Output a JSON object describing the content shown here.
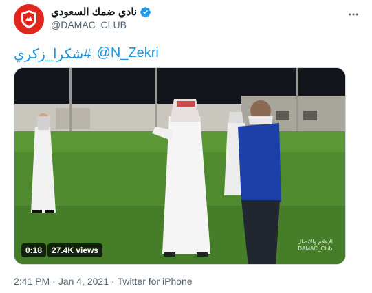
{
  "account": {
    "display_name": "نادي ضمك السعودي",
    "handle": "@DAMAC_CLUB"
  },
  "tweet": {
    "hashtag": "#شكرا_زكري",
    "mention": "@N_Zekri"
  },
  "video": {
    "duration": "0:18",
    "views": "27.4K views",
    "watermark_ar": "الإعلام والاتصال",
    "watermark_en": "DAMAC_Club"
  },
  "meta": {
    "time": "2:41 PM",
    "separator1": "·",
    "date": "Jan 4, 2021",
    "separator2": "·",
    "source": "Twitter for iPhone"
  },
  "colors": {
    "brand_red": "#e2261c",
    "link_blue": "#1b95e0",
    "verified_blue": "#1d9bf0",
    "muted": "#536471"
  },
  "icons": {
    "verified": "verified-badge-icon",
    "more": "more-options-icon",
    "avatar": "club-logo-icon"
  }
}
